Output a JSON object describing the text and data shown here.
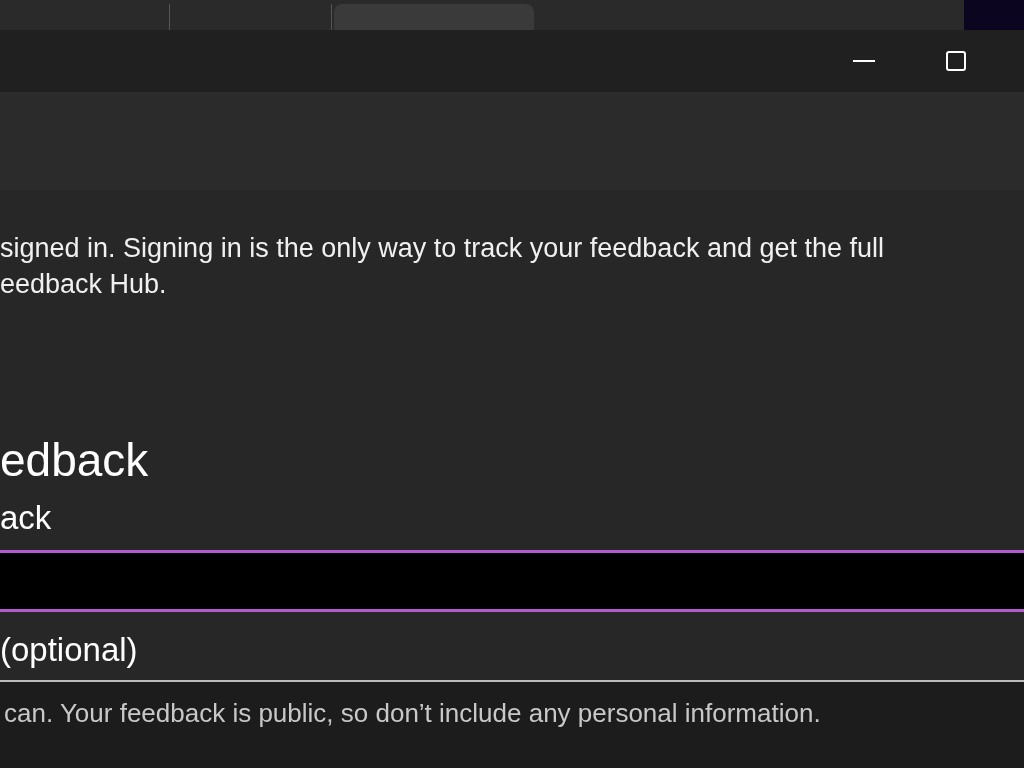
{
  "browser_strip": {
    "tabs": [
      {
        "selected": false
      },
      {
        "selected": false
      },
      {
        "selected": true
      }
    ]
  },
  "window": {
    "controls": [
      {
        "kind": "minimize"
      },
      {
        "kind": "maximize"
      }
    ]
  },
  "banner": {
    "lines": [
      "signed in. Signing in is the only way to track your feedback and get the full",
      "eedback Hub."
    ]
  },
  "form": {
    "heading": "edback",
    "summary": {
      "label": "ack",
      "focused": true
    },
    "details": {
      "label": "(optional)",
      "placeholder": "can. Your feedback is public, so don’t include any personal information.",
      "focused": false
    }
  }
}
